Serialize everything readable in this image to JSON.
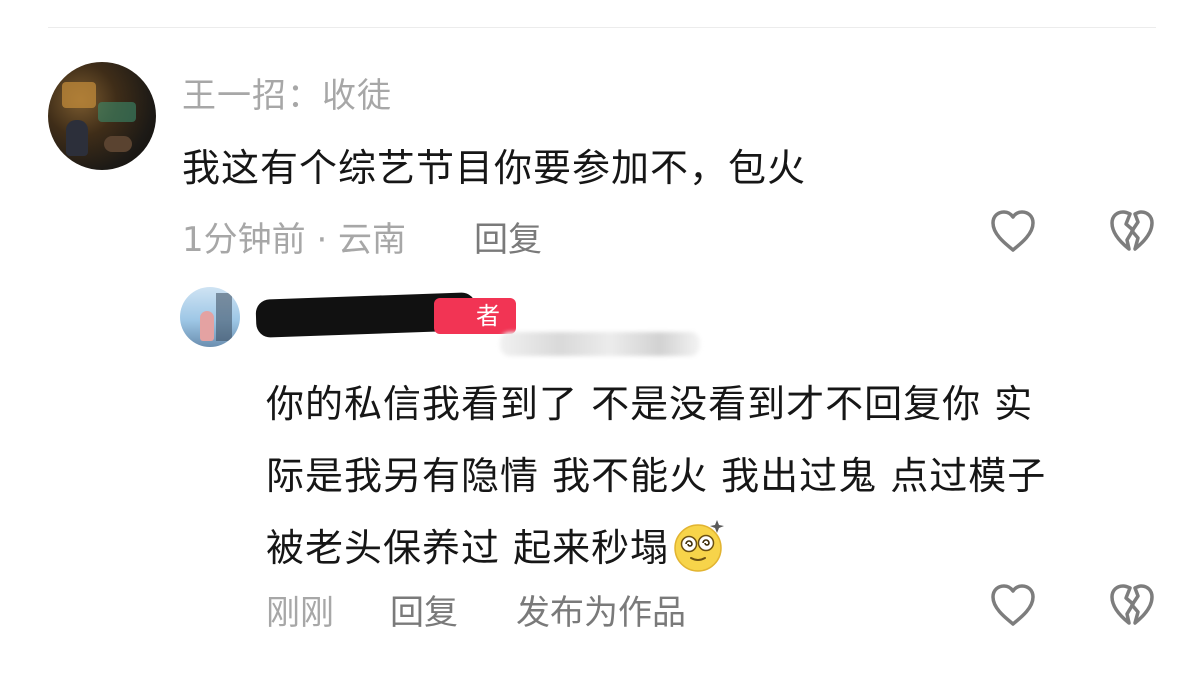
{
  "comment": {
    "username": "王一招：收徒",
    "text": "我这有个综艺节目你要参加不，包火",
    "meta": "1分钟前 · 云南",
    "reply_label": "回复",
    "like_icon": "heart-outline-icon",
    "dislike_icon": "broken-heart-icon"
  },
  "reply": {
    "author_badge": "者",
    "lines": [
      "你的私信我看到了 不是没看到才不回复你 实",
      "际是我另有隐情 我不能火 我出过鬼 点过模子",
      "被老头保养过 起来秒塌"
    ],
    "emoji": "dizzy-face-emoji",
    "time": "刚刚",
    "reply_label": "回复",
    "publish_label": "发布为作品",
    "like_icon": "heart-outline-icon",
    "dislike_icon": "broken-heart-icon"
  },
  "colors": {
    "secondary_text": "#a7a7a7",
    "action_text": "#7a7a7a",
    "primary_text": "#161616",
    "badge": "#f23454"
  }
}
